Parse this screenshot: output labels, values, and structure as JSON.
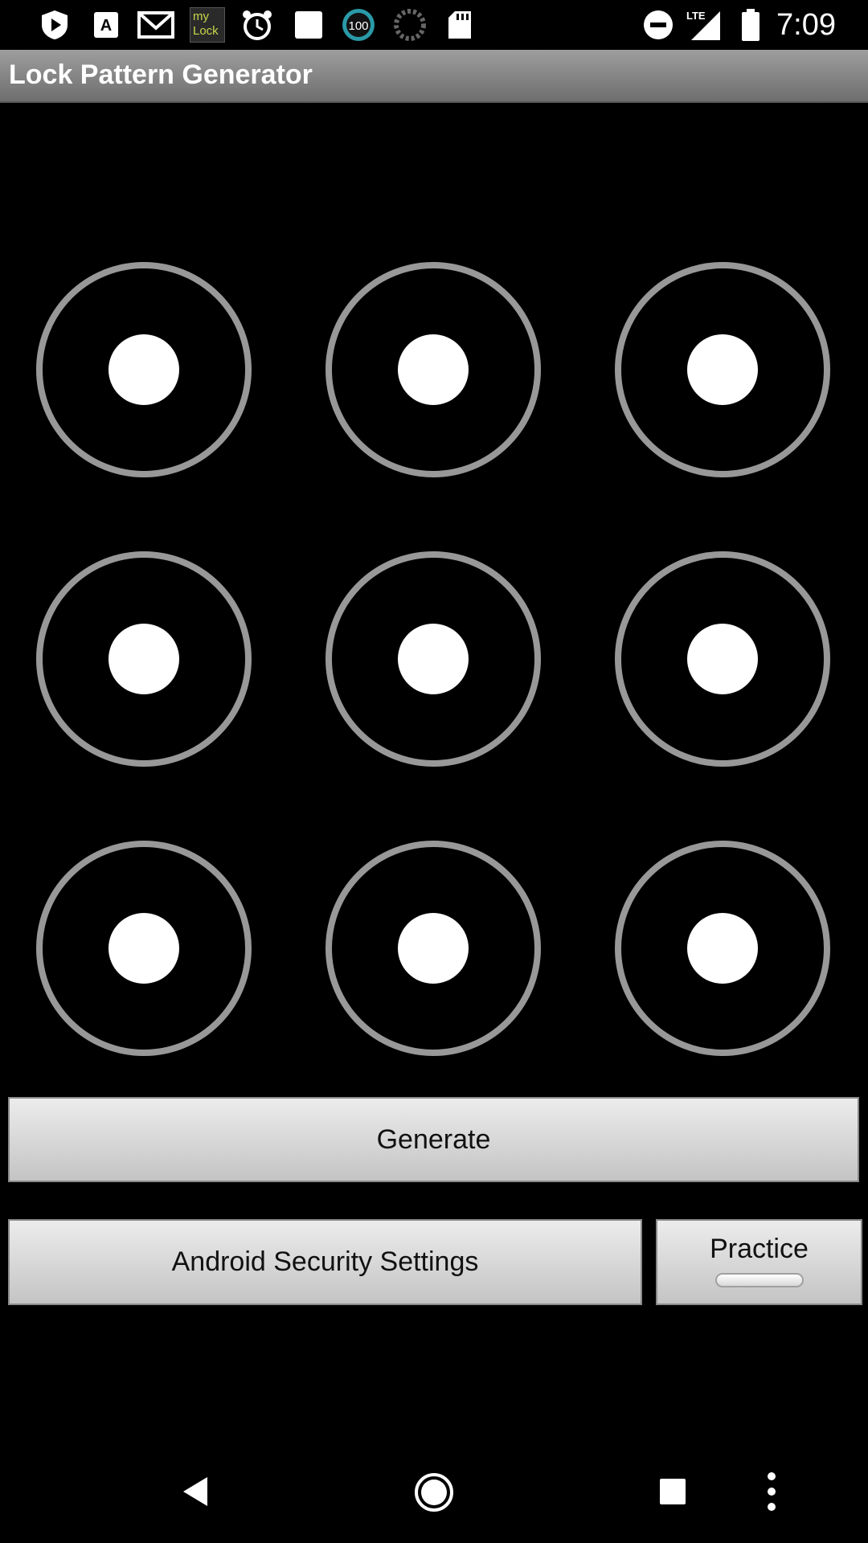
{
  "status_bar": {
    "time": "7:09",
    "mylock_label": "my Lock",
    "badge_100": "100",
    "lte_label": "LTE",
    "icons": [
      "play-shield-icon",
      "text-a-icon",
      "gmail-icon",
      "mylock-icon",
      "alarm-clock-icon",
      "square-notification-icon",
      "badge-100-icon",
      "loading-circle-icon",
      "sd-card-icon",
      "do-not-disturb-icon",
      "lte-signal-icon",
      "battery-icon"
    ]
  },
  "app": {
    "title": "Lock Pattern Generator"
  },
  "pattern": {
    "rows": 3,
    "columns": 3,
    "nodes": [
      "1",
      "2",
      "3",
      "4",
      "5",
      "6",
      "7",
      "8",
      "9"
    ]
  },
  "buttons": {
    "generate": "Generate",
    "security_settings": "Android Security Settings",
    "practice": "Practice"
  },
  "navigation": {
    "icons": [
      "back-icon",
      "home-icon",
      "recents-icon",
      "overflow-menu-icon"
    ]
  },
  "colors": {
    "background": "#000000",
    "ring": "#989898",
    "dot": "#ffffff",
    "title_bar": "#8a8a8a",
    "button": "#d6d6d6"
  }
}
